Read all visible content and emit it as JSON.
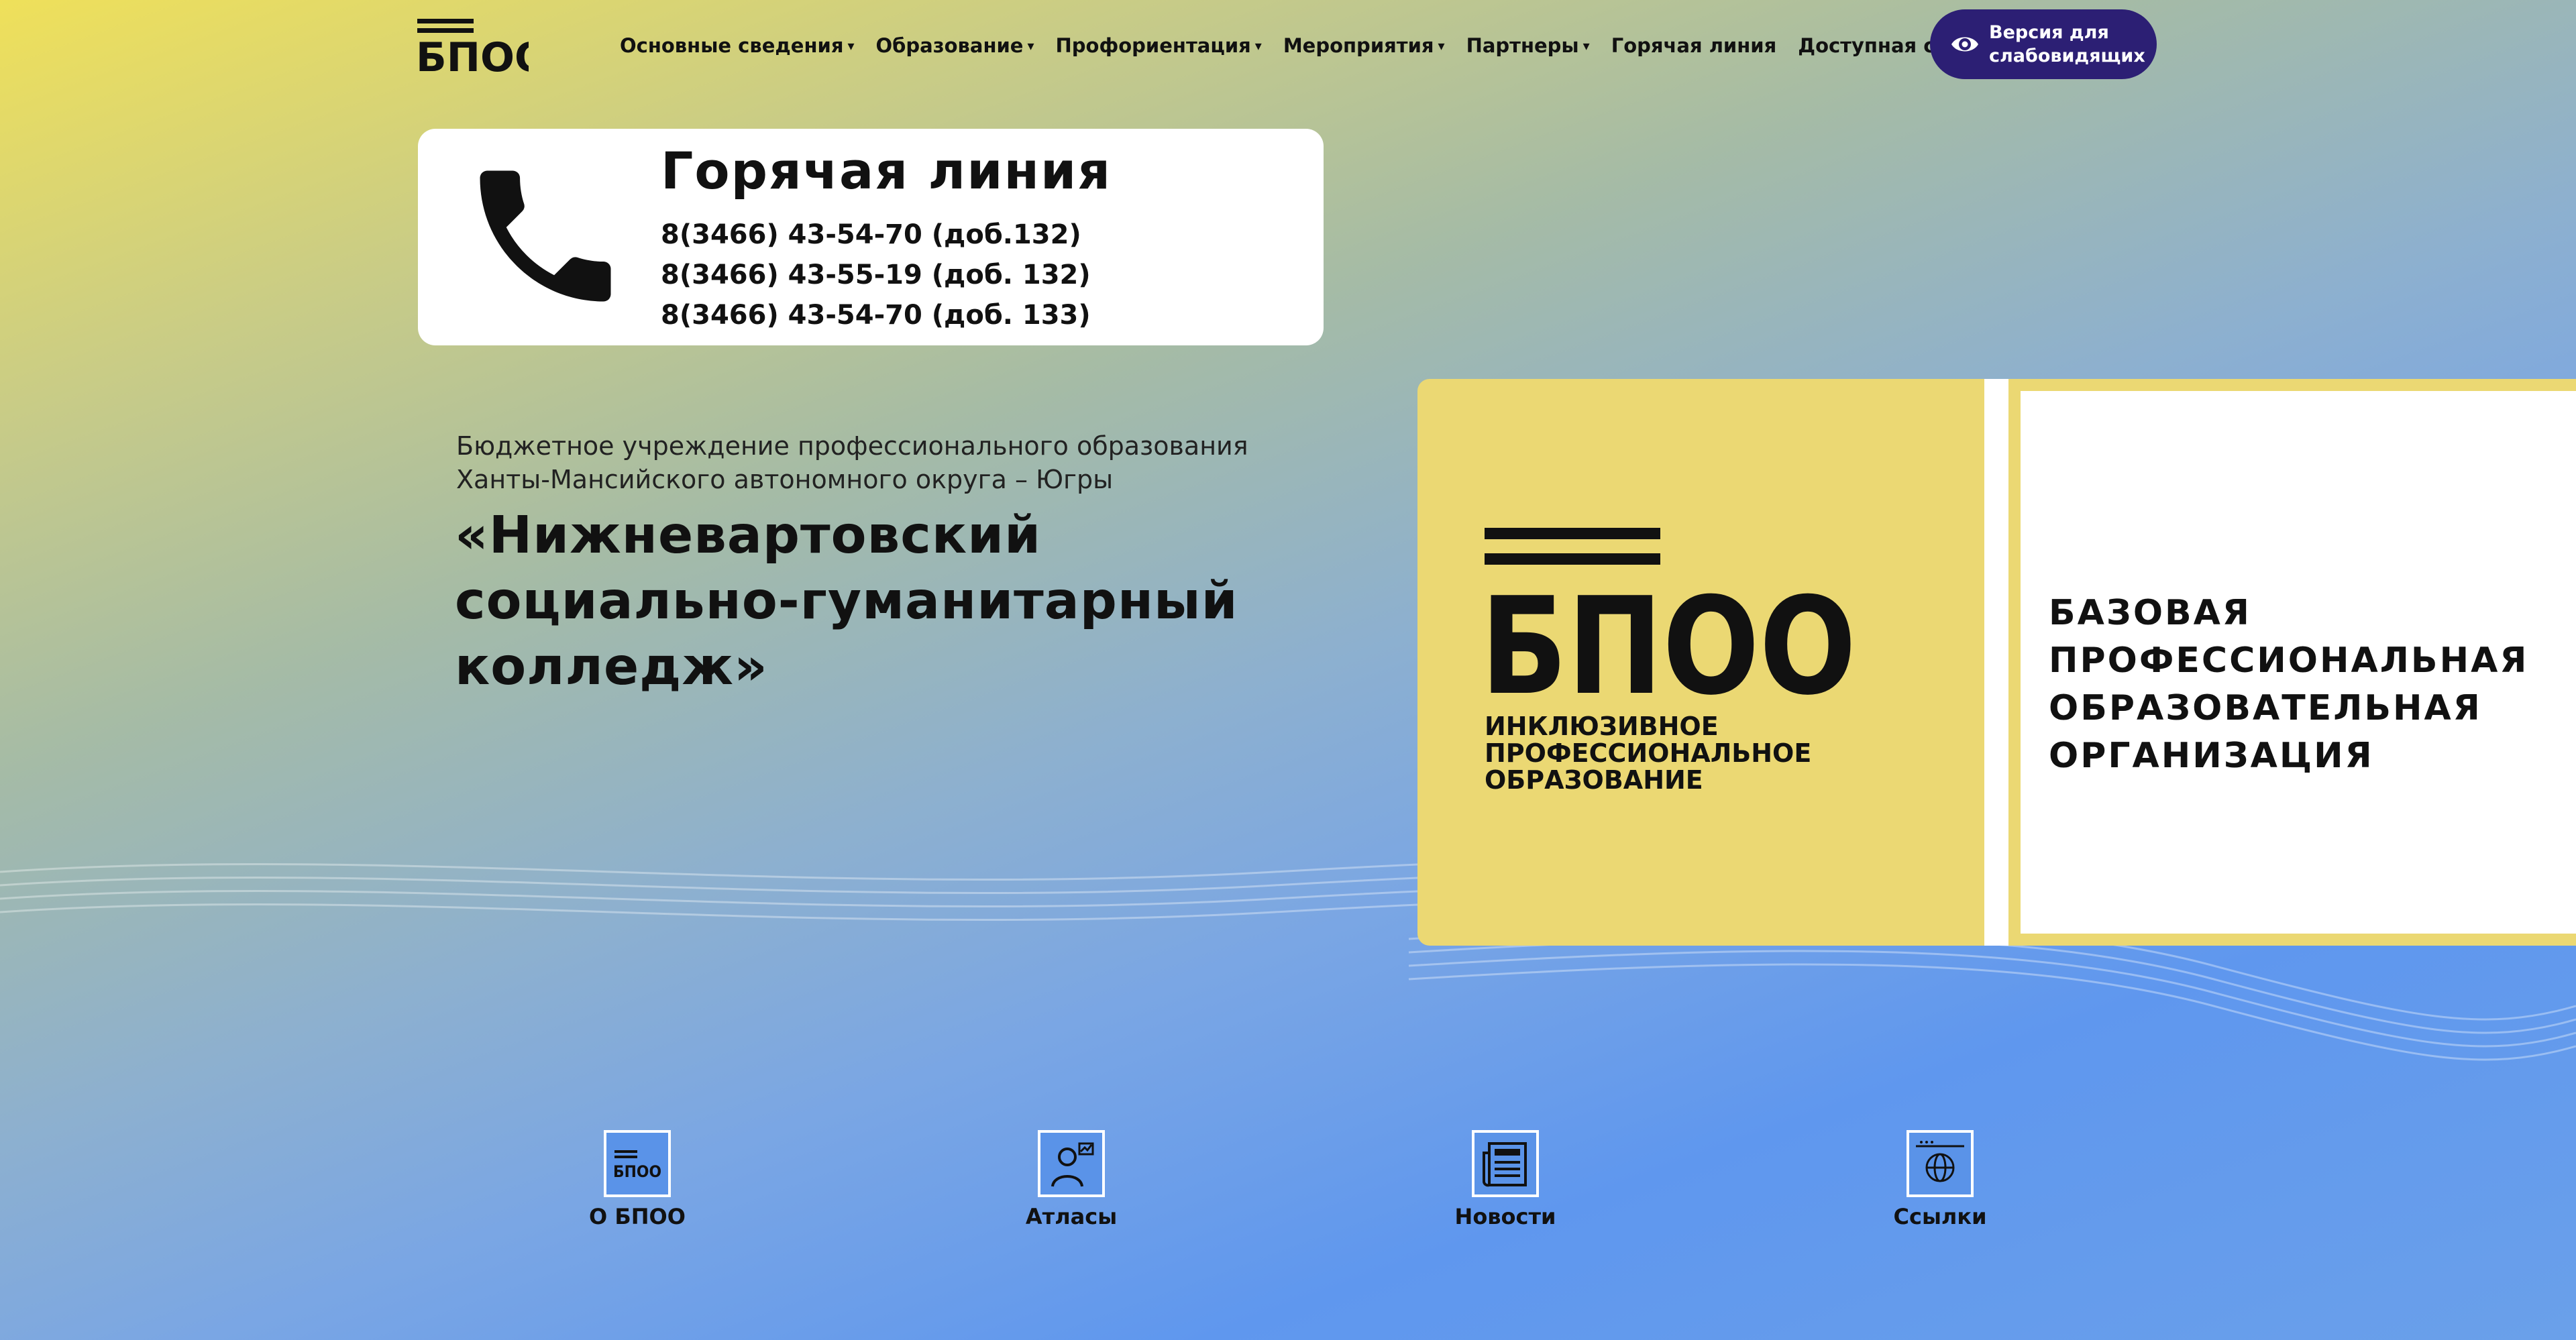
{
  "header": {
    "logo_text": "БПОО",
    "nav": [
      {
        "label": "Основные сведения",
        "has_dropdown": true
      },
      {
        "label": "Образование",
        "has_dropdown": true
      },
      {
        "label": "Профориентация",
        "has_dropdown": true
      },
      {
        "label": "Мероприятия",
        "has_dropdown": true
      },
      {
        "label": "Партнеры",
        "has_dropdown": true
      },
      {
        "label": "Горячая линия",
        "has_dropdown": false
      },
      {
        "label": "Доступная среда",
        "has_dropdown": false
      }
    ],
    "accessibility_button": "Версия для\nслабовидящих"
  },
  "hotline": {
    "title": "Горячая линия",
    "phones": [
      "8(3466) 43-54-70 (доб.132)",
      "8(3466) 43-55-19 (доб. 132)",
      "8(3466) 43-54-70 (доб. 133)"
    ]
  },
  "intro": {
    "subtitle": "Бюджетное учреждение профессионального образования\nХанты-Мансийского автономного округа – Югры",
    "name": "«Нижневартовский\nсоциально-гуманитарный\nколледж»"
  },
  "banner": {
    "logo_text": "БПОО",
    "logo_subtitle": "ИНКЛЮЗИВНОЕ\nПРОФЕССИОНАЛЬНОЕ\nОБРАЗОВАНИЕ",
    "right_text": "БАЗОВАЯ\nПРОФЕССИОНАЛЬНАЯ\nОБРАЗОВАТЕЛЬНАЯ\nОРГАНИЗАЦИЯ"
  },
  "tiles": [
    {
      "label": "О БПОО",
      "icon": "bpoo-logo-icon"
    },
    {
      "label": "Атласы",
      "icon": "atlas-person-icon"
    },
    {
      "label": "Новости",
      "icon": "newspaper-icon"
    },
    {
      "label": "Ссылки",
      "icon": "globe-icon"
    }
  ],
  "colors": {
    "accent_purple": "#2c1f74",
    "banner_yellow": "#ebd873",
    "background_top": "#efe05a",
    "background_bottom": "#5f97ee"
  }
}
